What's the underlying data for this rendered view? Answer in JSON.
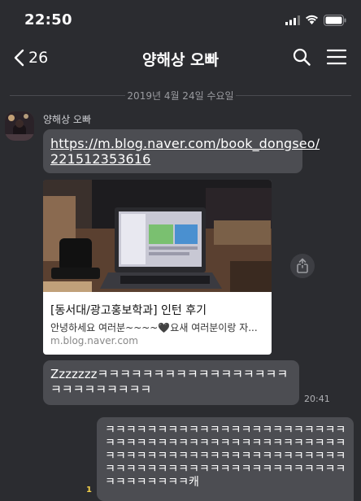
{
  "status_bar": {
    "time": "22:50"
  },
  "header": {
    "back_count": "26",
    "title": "양해상 오빠"
  },
  "date_divider": "2019년 4월 24일 수요일",
  "conversation": {
    "sender_name": "양해상 오빠",
    "link_message_line1": "https://m.blog.naver.com/book_dongseo/",
    "link_message_line2": "221512353616",
    "preview": {
      "title": "[동서대/광고홍보학과] 인턴 후기",
      "description": "안녕하세요 여러분~~~~🖤요새 여러분이랑 자...",
      "domain": "m.blog.naver.com"
    },
    "z_message": "Zzzzzzzㅋㅋㅋㅋㅋㅋㅋㅋㅋㅋㅋㅋㅋㅋㅋㅋㅋㅋㅋㅋㅋㅋㅋㅋㅋㅋ",
    "z_message_time": "20:41",
    "my_message": "ㅋㅋㅋㅋㅋㅋㅋㅋㅋㅋㅋㅋㅋㅋㅋㅋㅋㅋㅋㅋㅋㅋㅋㅋㅋㅋㅋㅋㅋㅋㅋㅋㅋㅋㅋㅋㅋㅋㅋㅋㅋㅋㅋㅋㅋㅋㅋㅋㅋㅋㅋㅋㅋㅋㅋㅋㅋㅋㅋㅋㅋㅋㅋㅋㅋㅋㅋㅋㅋㅋㅋㅋㅋㅋㅋㅋㅋㅋㅋㅋㅋㅋㅋㅋㅋㅋㅋㅋㅋㅋㅋㅋㅋㅋㅋㅋㅋㅋㅋㅋ캐",
    "my_message_unread": "1"
  },
  "icons": {
    "back": "chevron-left-icon",
    "search": "search-icon",
    "menu": "hamburger-menu-icon",
    "share": "share-icon",
    "signal": "cellular-signal-icon",
    "wifi": "wifi-icon",
    "battery": "battery-icon"
  },
  "colors": {
    "background": "#2b2c30",
    "bubble": "#4c4d52",
    "unread": "#f5d24a"
  }
}
